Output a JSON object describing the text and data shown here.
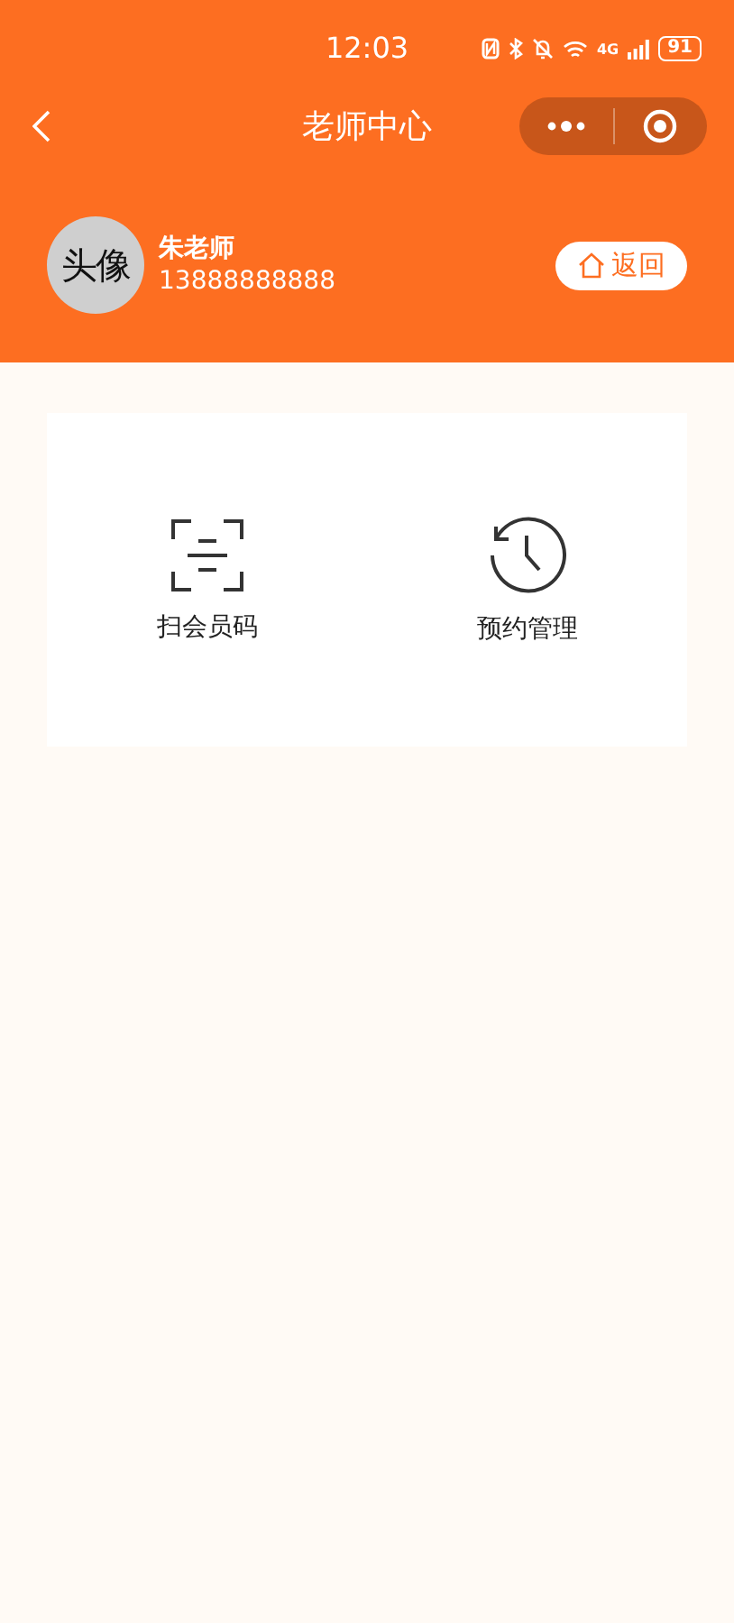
{
  "status_bar": {
    "time": "12:03",
    "network": "4G",
    "battery": "91"
  },
  "nav_bar": {
    "title": "老师中心"
  },
  "profile": {
    "avatar": "头像",
    "name": "朱老师",
    "phone": "13888888888",
    "back_button": "返回"
  },
  "actions": [
    {
      "kind": "scan",
      "label": "扫会员码"
    },
    {
      "kind": "history",
      "label": "预约管理"
    }
  ]
}
